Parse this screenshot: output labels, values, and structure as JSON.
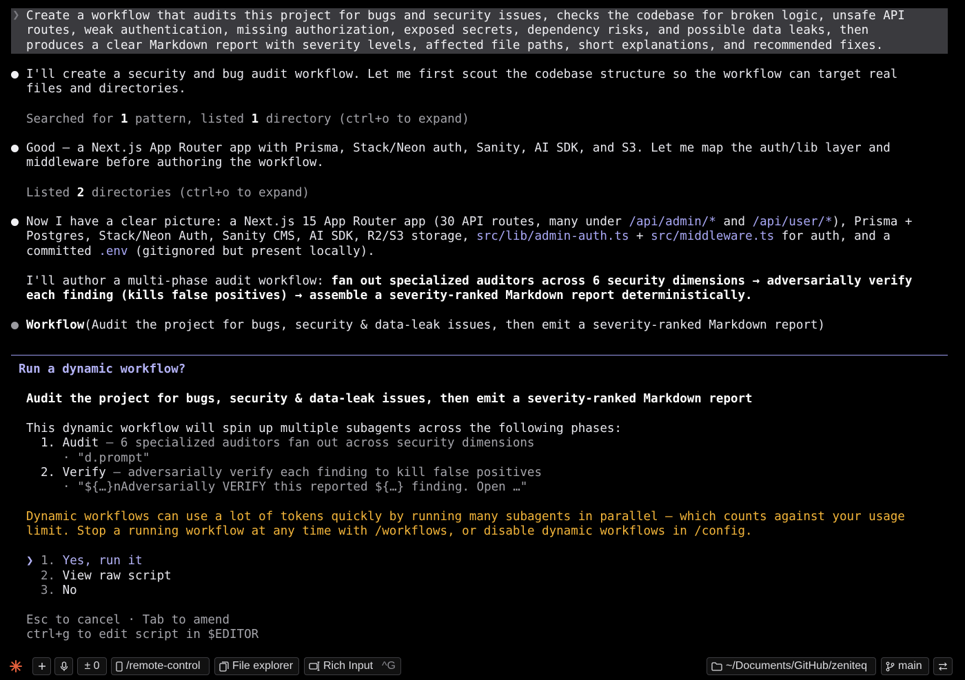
{
  "prompt": {
    "caret": "❯",
    "text": "Create a workflow that audits this project for bugs and security issues, checks the codebase for broken logic, unsafe API routes, weak authentication, missing authorization, exposed secrets, dependency risks, and possible data leaks, then produces a clear Markdown report with severity levels, affected file paths, short explanations, and recommended fixes."
  },
  "messages": {
    "m1": "I'll create a security and bug audit workflow. Let me first scout the codebase structure so the workflow can target real files and directories.",
    "tool1": {
      "a": "Searched for ",
      "n1": "1",
      "b": " pattern, listed ",
      "n2": "1",
      "c": " directory (ctrl+o to expand)"
    },
    "m2": "Good — a Next.js App Router app with Prisma, Stack/Neon auth, Sanity, AI SDK, and S3. Let me map the auth/lib layer and middleware before authoring the workflow.",
    "tool2": {
      "a": "Listed ",
      "n1": "2",
      "b": " directories (ctrl+o to expand)"
    },
    "m3": {
      "p1": "Now I have a clear picture: a Next.js 15 App Router app (30 API routes, many under ",
      "l1": "/api/admin/*",
      "p2": " and ",
      "l2": "/api/user/*",
      "p3": "), Prisma + Postgres, Stack/Neon Auth, Sanity CMS, AI SDK, R2/S3 storage, ",
      "l3": "src/lib/admin-auth.ts",
      "p4": " + ",
      "l4": "src/middleware.ts",
      "p5": " for auth, and a committed ",
      "l5": ".env",
      "p6": " (gitignored but present locally)."
    },
    "m4": {
      "p1": "I'll author a multi-phase audit workflow: ",
      "bold": "fan out specialized auditors across 6 security dimensions → adversarially verify each finding (kills false positives) → assemble a severity-ranked Markdown report deterministically."
    },
    "m5": {
      "name": "Workflow",
      "args": "(Audit the project for bugs, security & data-leak issues, then emit a severity-ranked Markdown report)"
    }
  },
  "dialog": {
    "title": "Run a dynamic workflow?",
    "heading": "Audit the project for bugs, security & data-leak issues, then emit a severity-ranked Markdown report",
    "intro": "This dynamic workflow will spin up multiple subagents across the following phases:",
    "phases": [
      {
        "num": "1.",
        "name": "Audit",
        "desc": " — 6 specialized auditors fan out across security dimensions",
        "detail": "· \"d.prompt\""
      },
      {
        "num": "2.",
        "name": "Verify",
        "desc": " — adversarially verify each finding to kill false positives",
        "detail": "· \"${…}nAdversarially VERIFY this reported ${…} finding. Open …\""
      }
    ],
    "warning": "Dynamic workflows can use a lot of tokens quickly by running many subagents in parallel — which counts against your usage limit. Stop a running workflow at any time with /workflows, or disable dynamic workflows in /config.",
    "options": [
      {
        "num": "1.",
        "label": "Yes, run it",
        "selected": true
      },
      {
        "num": "2.",
        "label": "View raw script",
        "selected": false
      },
      {
        "num": "3.",
        "label": "No",
        "selected": false
      }
    ],
    "pointer": "❯",
    "hint1": "Esc to cancel · Tab to amend",
    "hint2": "ctrl+g to edit script in $EDITOR"
  },
  "statusbar": {
    "diff_count": "± 0",
    "remote": "/remote-control",
    "file_explorer": "File explorer",
    "rich_input": "Rich Input",
    "rich_input_kbd": "^G",
    "path": "~/Documents/GitHub/zeniteq",
    "branch": "main"
  },
  "colors": {
    "background": "#000000",
    "accent": "#b4b3f7",
    "warning": "#f3b53a",
    "logo": "#e5603c"
  }
}
